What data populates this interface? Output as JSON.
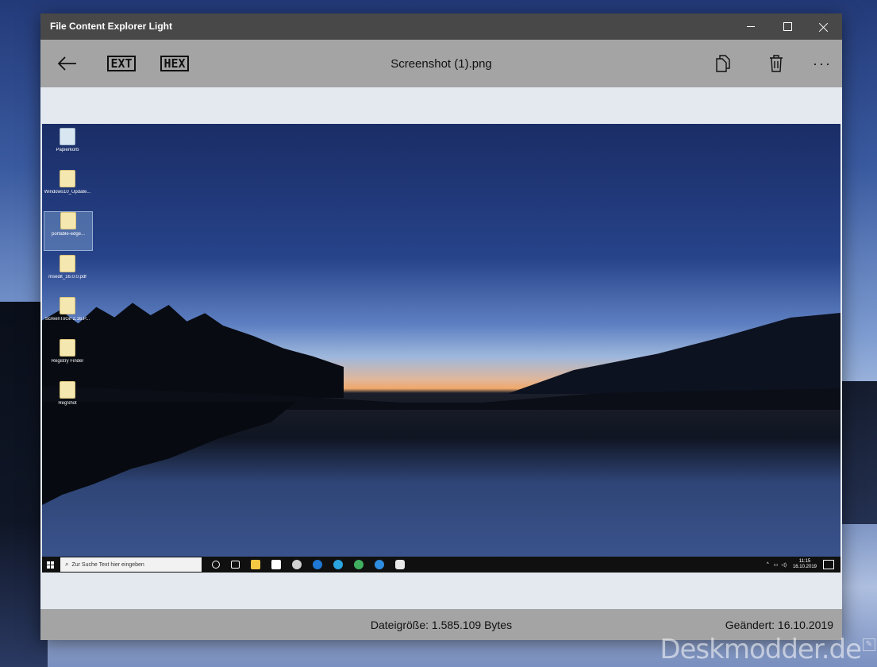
{
  "window": {
    "title": "File Content Explorer Light"
  },
  "toolbar": {
    "back_icon": "arrow-left-icon",
    "ext_label": "EXT",
    "hex_label": "HEX",
    "file_name": "Screenshot (1).png",
    "copy_icon": "copy-icon",
    "delete_icon": "trash-icon",
    "more_icon": "more-icon"
  },
  "preview": {
    "desktop_icons": [
      {
        "label": "Papierkorb"
      },
      {
        "label": "Windows10_Update..."
      },
      {
        "label": "portable-edge..."
      },
      {
        "label": "msedit_16.0.0.pdf"
      },
      {
        "label": "ScreenToGif 2.16.P..."
      },
      {
        "label": "Registry Finder"
      },
      {
        "label": "RegShot"
      }
    ],
    "taskbar": {
      "search_placeholder": "Zur Suche Text hier eingeben",
      "time": "11:15",
      "date": "16.10.2019"
    }
  },
  "status": {
    "file_size": "Dateigröße: 1.585.109 Bytes",
    "modified": "Geändert: 16.10.2019"
  },
  "watermark": "Deskmodder.de",
  "colors": {
    "titlebar": "#484848",
    "toolbar": "#a4a4a4",
    "content": "#e4e9f0"
  }
}
